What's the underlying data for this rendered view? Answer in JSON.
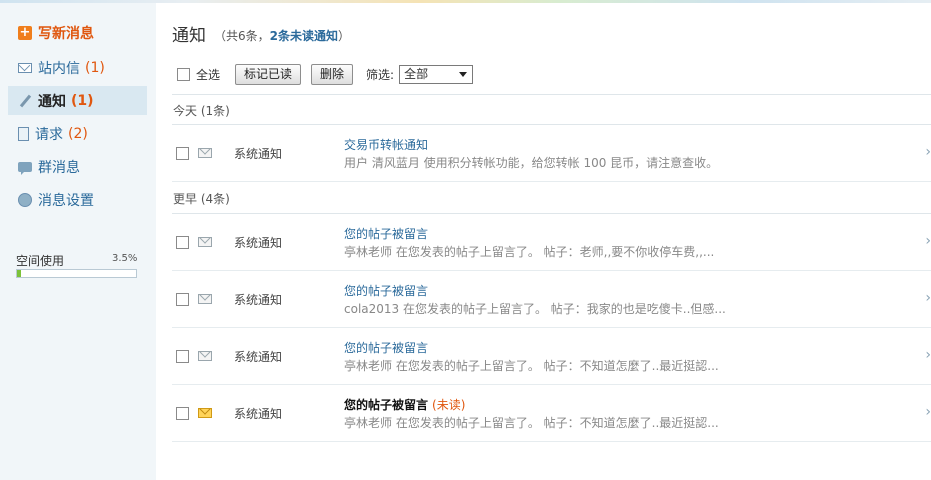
{
  "sidebar": {
    "compose_label": "写新消息",
    "items": [
      {
        "label": "站内信",
        "count": "(1)",
        "icon": "mail-icon"
      },
      {
        "label": "通知",
        "count": "(1)",
        "icon": "pencil-icon"
      },
      {
        "label": "请求",
        "count": "(2)",
        "icon": "document-icon"
      },
      {
        "label": "群消息",
        "count": "",
        "icon": "chat-icon"
      },
      {
        "label": "消息设置",
        "count": "",
        "icon": "settings-icon"
      }
    ],
    "space_label": "空间使用",
    "space_pct": "3.5%",
    "space_fraction": 0.035
  },
  "main": {
    "title": "通知",
    "subtitle_prefix": "（共6条，",
    "subtitle_unread": "2条未读通知",
    "subtitle_suffix": "）",
    "toolbar": {
      "select_all": "全选",
      "mark_read": "标记已读",
      "delete": "删除",
      "filter_label": "筛选:",
      "filter_value": "全部"
    },
    "groups": [
      {
        "heading": "今天 (1条)"
      },
      {
        "heading": "更早 (4条)"
      }
    ],
    "rows": [
      {
        "sender": "系统通知",
        "subject": "交易币转帐通知",
        "preview": "用户 清风蓝月 使用积分转帐功能，给您转帐  100 昆币，请注意查收。",
        "unread_tag": ""
      },
      {
        "sender": "系统通知",
        "subject": "您的帖子被留言",
        "preview": "亭林老师 在您发表的帖子上留言了。  帖子：老师,,要不你收停车费,,...",
        "unread_tag": ""
      },
      {
        "sender": "系统通知",
        "subject": "您的帖子被留言",
        "preview": "cola2013 在您发表的帖子上留言了。  帖子：我家的也是吃傻卡..但感...",
        "unread_tag": ""
      },
      {
        "sender": "系统通知",
        "subject": "您的帖子被留言",
        "preview": "亭林老师 在您发表的帖子上留言了。  帖子：不知道怎麼了..最近挺認...",
        "unread_tag": ""
      },
      {
        "sender": "系统通知",
        "subject": "您的帖子被留言",
        "preview": "亭林老师 在您发表的帖子上留言了。  帖子：不知道怎麼了..最近挺認...",
        "unread_tag": "(未读)"
      }
    ]
  },
  "colors": {
    "accent_orange": "#e0570f",
    "link_blue": "#2b6a9b",
    "sidebar_bg": "#f1f6f9",
    "active_bg": "#d9e8f1"
  }
}
